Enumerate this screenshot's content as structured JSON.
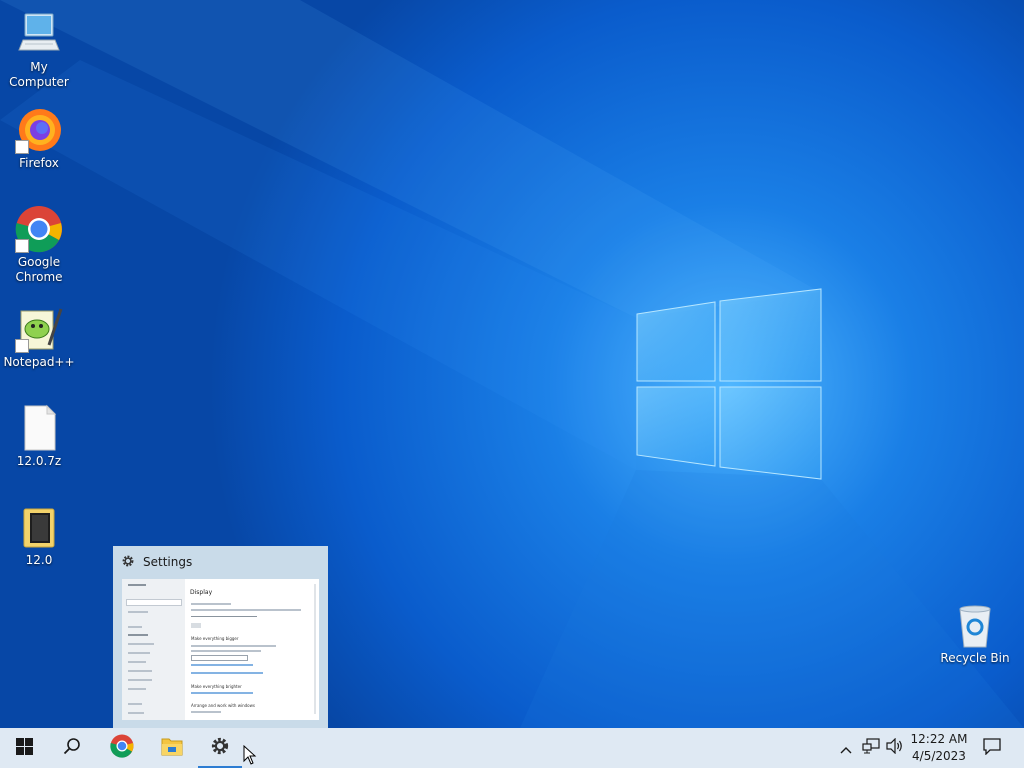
{
  "desktop": {
    "icons": [
      {
        "label": "My Computer",
        "icon": "computer-icon"
      },
      {
        "label": "Firefox",
        "icon": "firefox-icon"
      },
      {
        "label": "Google Chrome",
        "icon": "chrome-icon"
      },
      {
        "label": "Notepad++",
        "icon": "notepadpp-icon"
      },
      {
        "label": "12.0.7z",
        "icon": "file-icon"
      },
      {
        "label": "12.0",
        "icon": "folder-icon"
      },
      {
        "label": "Recycle Bin",
        "icon": "recycle-bin-icon"
      }
    ]
  },
  "preview": {
    "title": "Settings",
    "thumb": {
      "heading": "Display",
      "section1": "Make everything bigger",
      "section2": "Make everything brighter",
      "section3": "Arrange and work with windows"
    }
  },
  "taskbar": {
    "buttons": [
      "start-icon",
      "search-icon",
      "chrome-icon",
      "file-explorer-icon",
      "settings-icon"
    ],
    "active": "settings-icon",
    "clock": {
      "time": "12:22 AM",
      "date": "4/5/2023"
    }
  },
  "colors": {
    "wallpaper": "#0a5fd0",
    "taskbar": "#dfe9f3",
    "accent": "#2d7dd2"
  }
}
